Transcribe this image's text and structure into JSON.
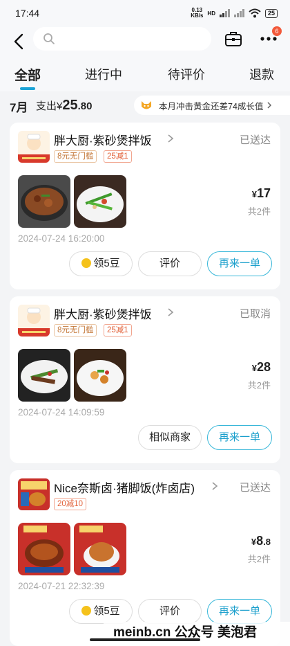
{
  "status_bar": {
    "time": "17:44",
    "net_speed_value": "0.13",
    "net_speed_unit": "KB/s",
    "hd": "HD",
    "battery": "25"
  },
  "header": {
    "search_placeholder": "",
    "notification_count": "6"
  },
  "tabs": [
    {
      "label": "全部",
      "active": true
    },
    {
      "label": "进行中",
      "active": false
    },
    {
      "label": "待评价",
      "active": false
    },
    {
      "label": "退款",
      "active": false
    }
  ],
  "summary": {
    "month": "7月",
    "spend_label": "支出",
    "currency": "¥",
    "amount_int": "25",
    "amount_dec": ".80",
    "promo_text": "本月冲击黄金还差74成长值"
  },
  "orders": [
    {
      "shop": "胖大厨·紫砂煲拌饭",
      "status": "已送达",
      "tags": [
        "8元无门槛",
        "25减1"
      ],
      "currency": "¥",
      "price_int": "17",
      "price_dec": "",
      "count": "共2件",
      "time": "2024-07-24 16:20:00",
      "buttons": [
        "领5豆",
        "评价",
        "再来一单"
      ]
    },
    {
      "shop": "胖大厨·紫砂煲拌饭",
      "status": "已取消",
      "tags": [
        "8元无门槛",
        "25减1"
      ],
      "currency": "¥",
      "price_int": "28",
      "price_dec": "",
      "count": "共2件",
      "time": "2024-07-24 14:09:59",
      "buttons": [
        "相似商家",
        "再来一单"
      ]
    },
    {
      "shop": "Nice奈斯卤·猪脚饭(炸卤店)",
      "status": "已送达",
      "tags": [
        "20减10"
      ],
      "currency": "¥",
      "price_int": "8",
      "price_dec": ".8",
      "count": "共2件",
      "time": "2024-07-21 22:32:39",
      "buttons": [
        "领5豆",
        "评价",
        "再来一单"
      ]
    }
  ],
  "watermark": "meinb.cn 公众号 美泡君",
  "colors": {
    "accent": "#1aa3d6",
    "tag": "#e2623a",
    "badge": "#f2593a"
  }
}
